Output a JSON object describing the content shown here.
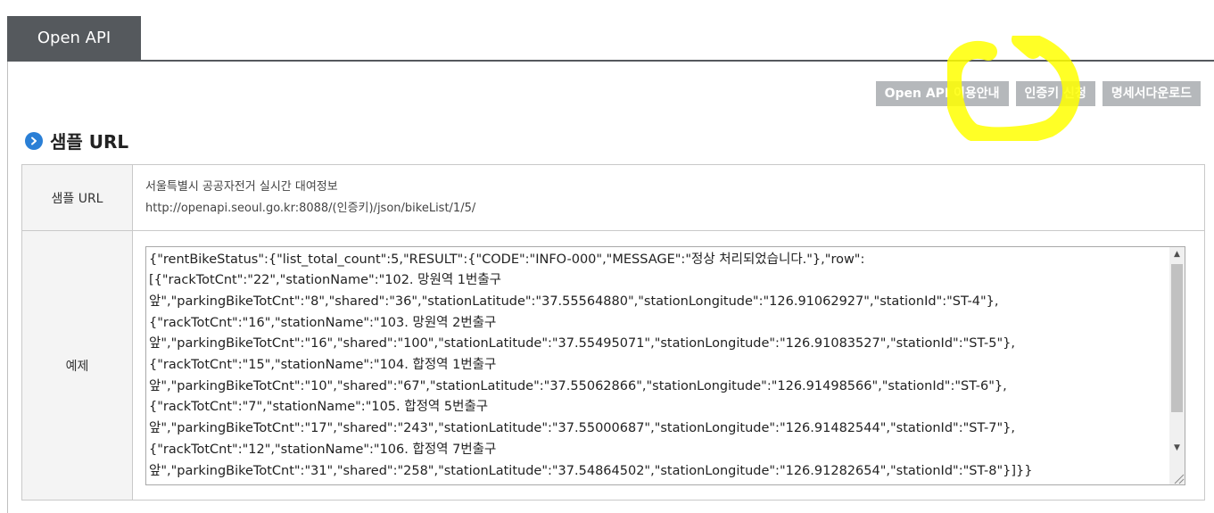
{
  "tab": {
    "label": "Open API"
  },
  "buttons": {
    "guide": "Open API 이용안내",
    "auth_key": "인증키 신청",
    "spec_download": "명세서다운로드"
  },
  "section": {
    "title": "샘플 URL"
  },
  "table": {
    "sample_url_label": "샘플 URL",
    "sample_url_desc": "서울특별시 공공자전거 실시간 대여정보",
    "sample_url": "http://openapi.seoul.go.kr:8088/(인증키)/json/bikeList/1/5/",
    "example_label": "예제",
    "example_json": "{\"rentBikeStatus\":{\"list_total_count\":5,\"RESULT\":{\"CODE\":\"INFO-000\",\"MESSAGE\":\"정상 처리되었습니다.\"},\"row\":\n[{\"rackTotCnt\":\"22\",\"stationName\":\"102. 망원역 1번출구\n앞\",\"parkingBikeTotCnt\":\"8\",\"shared\":\"36\",\"stationLatitude\":\"37.55564880\",\"stationLongitude\":\"126.91062927\",\"stationId\":\"ST-4\"},\n{\"rackTotCnt\":\"16\",\"stationName\":\"103. 망원역 2번출구\n앞\",\"parkingBikeTotCnt\":\"16\",\"shared\":\"100\",\"stationLatitude\":\"37.55495071\",\"stationLongitude\":\"126.91083527\",\"stationId\":\"ST-5\"},\n{\"rackTotCnt\":\"15\",\"stationName\":\"104. 합정역 1번출구\n앞\",\"parkingBikeTotCnt\":\"10\",\"shared\":\"67\",\"stationLatitude\":\"37.55062866\",\"stationLongitude\":\"126.91498566\",\"stationId\":\"ST-6\"},\n{\"rackTotCnt\":\"7\",\"stationName\":\"105. 합정역 5번출구\n앞\",\"parkingBikeTotCnt\":\"17\",\"shared\":\"243\",\"stationLatitude\":\"37.55000687\",\"stationLongitude\":\"126.91482544\",\"stationId\":\"ST-7\"},\n{\"rackTotCnt\":\"12\",\"stationName\":\"106. 합정역 7번출구\n앞\",\"parkingBikeTotCnt\":\"31\",\"shared\":\"258\",\"stationLatitude\":\"37.54864502\",\"stationLongitude\":\"126.91282654\",\"stationId\":\"ST-8\"}]}}"
  },
  "icons": {
    "section": "chevron-right-circle-icon",
    "scroll_up": "triangle-up-icon",
    "scroll_down": "triangle-down-icon",
    "resize": "resize-grip-icon"
  },
  "colors": {
    "tab_bg": "#55595d",
    "button_bg": "#b5b8bb",
    "icon_blue": "#2a7fd6",
    "highlight": "#ffff00",
    "label_bg": "#f4f4f4"
  }
}
